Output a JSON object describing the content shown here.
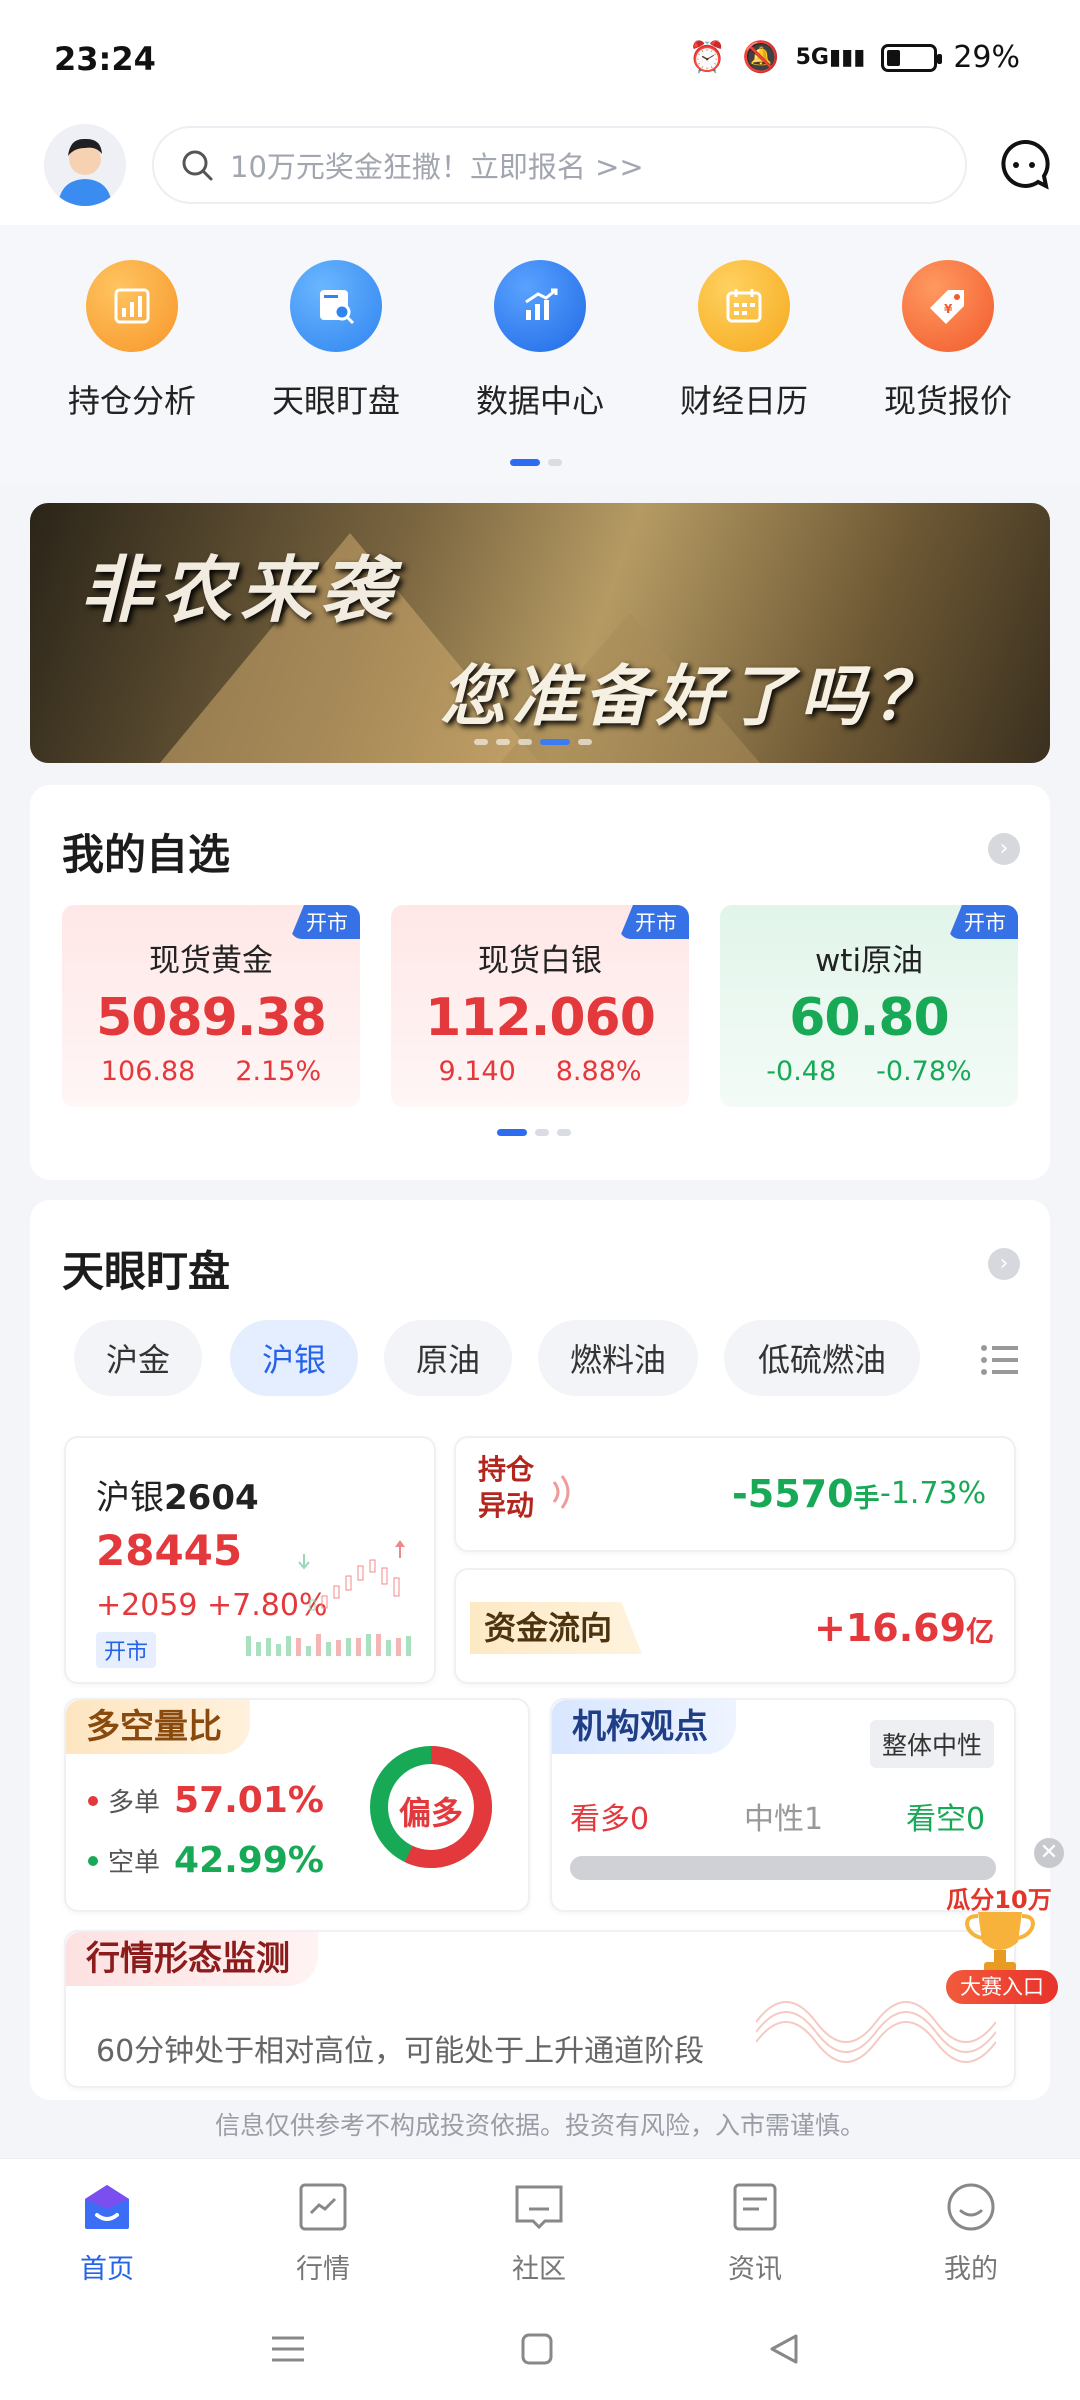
{
  "status": {
    "time": "23:24",
    "network": "5G",
    "battery": "29%",
    "battery_level": 0.29
  },
  "header": {
    "search_placeholder": "10万元奖金狂撒！立即报名 >>"
  },
  "quick_links": [
    {
      "label": "持仓分析",
      "icon": "chart-analysis-icon",
      "color": "#f7a12f"
    },
    {
      "label": "天眼盯盘",
      "icon": "monitor-search-icon",
      "color": "#3c8ef3"
    },
    {
      "label": "数据中心",
      "icon": "data-bars-icon",
      "color": "#2f7ff1"
    },
    {
      "label": "财经日历",
      "icon": "calendar-icon",
      "color": "#f9b52c"
    },
    {
      "label": "现货报价",
      "icon": "price-tag-icon",
      "color": "#f5733b"
    }
  ],
  "banner": {
    "line1": "非农来袭",
    "line2": "您准备好了吗？"
  },
  "watchlist": {
    "title": "我的自选",
    "items": [
      {
        "tag": "开市",
        "name": "现货黄金",
        "price": "5089.38",
        "change": "106.88",
        "pct": "2.15%",
        "dir": "up"
      },
      {
        "tag": "开市",
        "name": "现货白银",
        "price": "112.060",
        "change": "9.140",
        "pct": "8.88%",
        "dir": "up"
      },
      {
        "tag": "开市",
        "name": "wti原油",
        "price": "60.80",
        "change": "-0.48",
        "pct": "-0.78%",
        "dir": "down"
      }
    ]
  },
  "monitor": {
    "title": "天眼盯盘",
    "tabs": [
      "沪金",
      "沪银",
      "原油",
      "燃料油",
      "低硫燃油"
    ],
    "active_tab": "沪银",
    "contract": {
      "name_prefix": "沪银",
      "name_code": "2604",
      "price": "28445",
      "change": "+2059",
      "pct": "+7.80%",
      "status": "开市"
    },
    "position_change": {
      "label_line1": "持仓",
      "label_line2": "异动",
      "value": "-5570",
      "unit": "手",
      "pct": "-1.73%"
    },
    "capital_flow": {
      "label": "资金流向",
      "value": "+16.69",
      "unit": "亿"
    },
    "long_short": {
      "label": "多空量比",
      "long_label": "多单",
      "long_pct": "57.01%",
      "long_value": 57.01,
      "short_label": "空单",
      "short_pct": "42.99%",
      "short_value": 42.99,
      "verdict": "偏多"
    },
    "institution": {
      "label": "机构观点",
      "overall": "整体中性",
      "bull": "看多0",
      "neutral": "中性1",
      "bear": "看空0"
    },
    "pattern": {
      "label": "行情形态监测",
      "text": "60分钟处于相对高位，可能处于上升通道阶段"
    }
  },
  "promo": {
    "top": "瓜分10万",
    "bottom": "大赛入口"
  },
  "disclaimer": "信息仅供参考不构成投资依据。投资有风险，入市需谨慎。",
  "tabs": [
    {
      "label": "首页",
      "icon": "home-icon",
      "active": true
    },
    {
      "label": "行情",
      "icon": "market-icon",
      "active": false
    },
    {
      "label": "社区",
      "icon": "community-icon",
      "active": false
    },
    {
      "label": "资讯",
      "icon": "news-icon",
      "active": false
    },
    {
      "label": "我的",
      "icon": "profile-icon",
      "active": false
    }
  ]
}
